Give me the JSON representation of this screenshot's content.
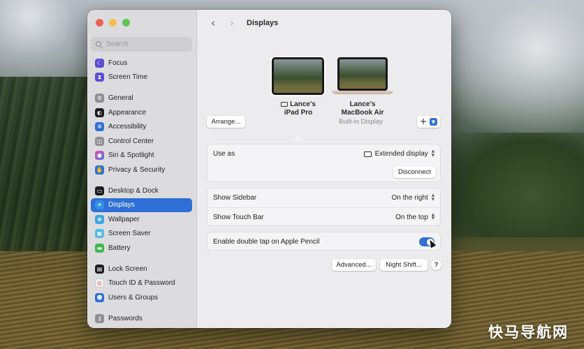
{
  "desktop": {
    "watermark": "快马导航网"
  },
  "window": {
    "title": "Displays",
    "search": {
      "placeholder": "Search"
    },
    "sidebar": {
      "items": [
        {
          "label": "Focus",
          "icon": "focus-moon-icon",
          "color": "#5b4fd1"
        },
        {
          "label": "Screen Time",
          "icon": "hourglass-icon",
          "color": "#5b4fd1"
        },
        {
          "label": "General",
          "icon": "gear-icon",
          "color": "#8e8e93"
        },
        {
          "label": "Appearance",
          "icon": "appearance-icon",
          "color": "#1c1c1e"
        },
        {
          "label": "Accessibility",
          "icon": "accessibility-icon",
          "color": "#2f6fd6"
        },
        {
          "label": "Control Center",
          "icon": "control-center-icon",
          "color": "#8e8e93"
        },
        {
          "label": "Siri & Spotlight",
          "icon": "siri-icon",
          "color": "#b044c8"
        },
        {
          "label": "Privacy & Security",
          "icon": "hand-icon",
          "color": "#2f6fd6"
        },
        {
          "label": "Desktop & Dock",
          "icon": "dock-icon",
          "color": "#1c1c1e"
        },
        {
          "label": "Displays",
          "icon": "displays-icon",
          "color": "#2f8fe8",
          "selected": true
        },
        {
          "label": "Wallpaper",
          "icon": "wallpaper-icon",
          "color": "#39a7e0"
        },
        {
          "label": "Screen Saver",
          "icon": "screen-saver-icon",
          "color": "#4fbbe6"
        },
        {
          "label": "Battery",
          "icon": "battery-icon",
          "color": "#3fb950"
        },
        {
          "label": "Lock Screen",
          "icon": "lock-screen-icon",
          "color": "#1c1c1e"
        },
        {
          "label": "Touch ID & Password",
          "icon": "fingerprint-icon",
          "color": "#f2f2f4"
        },
        {
          "label": "Users & Groups",
          "icon": "users-icon",
          "color": "#2f6fd6"
        },
        {
          "label": "Passwords",
          "icon": "key-icon",
          "color": "#8e8e93"
        }
      ]
    },
    "displays": {
      "devices": [
        {
          "name_line1": "Lance's",
          "name_line2": "iPad Pro",
          "selected": true
        },
        {
          "name_line1": "Lance's",
          "name_line2": "MacBook Air",
          "subtitle": "Built-in Display"
        }
      ],
      "arrange_label": "Arrange...",
      "add_label": "+"
    },
    "settings": {
      "use_as": {
        "label": "Use as",
        "value": "Extended display"
      },
      "disconnect_label": "Disconnect",
      "show_sidebar": {
        "label": "Show Sidebar",
        "value": "On the right"
      },
      "show_touch_bar": {
        "label": "Show Touch Bar",
        "value": "On the top"
      },
      "double_tap": {
        "label": "Enable double tap on Apple Pencil",
        "enabled": true
      }
    },
    "footer": {
      "advanced_label": "Advanced...",
      "night_shift_label": "Night Shift...",
      "help_label": "?"
    }
  }
}
